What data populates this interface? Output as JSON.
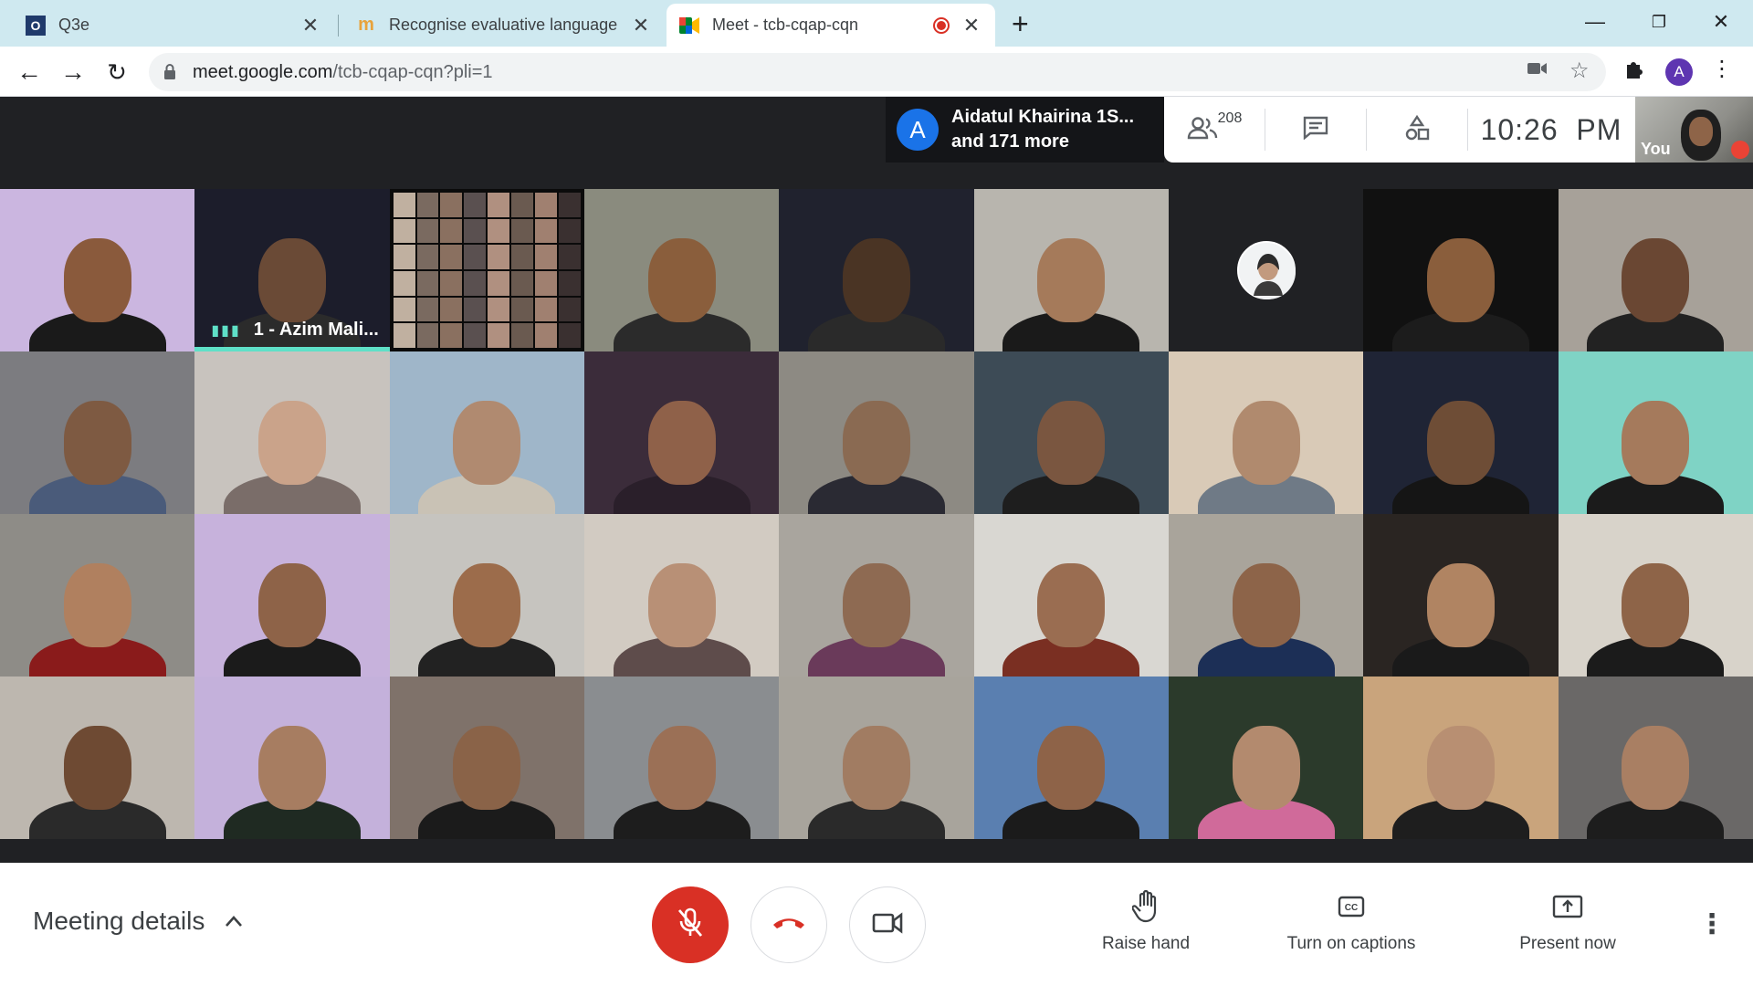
{
  "browser": {
    "tabs": [
      {
        "title": "Q3e",
        "favicon": "O",
        "favicon_bg": "#1f3a6b",
        "active": false
      },
      {
        "title": "Recognise evaluative language",
        "favicon": "m",
        "favicon_bg": "#e8a33c",
        "active": false
      },
      {
        "title": "Meet - tcb-cqap-cqn",
        "favicon": "meet-icon",
        "active": true,
        "recording_indicator": true
      }
    ],
    "new_tab_label": "+",
    "url_host": "meet.google.com",
    "url_path": "/tcb-cqap-cqn?pli=1",
    "profile_initial": "A"
  },
  "meet": {
    "presenter": {
      "avatar_initial": "A",
      "line1": "Aidatul Khairina 1S...",
      "line2": "and 171 more"
    },
    "participant_count": "208",
    "time": "10:26  PM",
    "self_label": "You",
    "speaking_tile_name": "1 - Azim Mali...",
    "tiles": [
      {
        "bg": "#cbb6e0",
        "skin": "#8a5a3c",
        "wear": "#1a1a1a"
      },
      {
        "bg": "#1c1d2b",
        "skin": "#6a4a36",
        "wear": "#2b2b2b",
        "speaking": true
      },
      {
        "collage": true
      },
      {
        "bg": "#8a8b7e",
        "skin": "#8a5e3c",
        "wear": "#2b2b2b"
      },
      {
        "bg": "#20222e",
        "skin": "#4a3424",
        "wear": "#2a2a2a"
      },
      {
        "bg": "#b8b5ae",
        "skin": "#a57a5a",
        "wear": "#1a1a1a"
      },
      {
        "avatar_only": true,
        "bg": "#202124"
      },
      {
        "bg": "#111111",
        "skin": "#8a5e3c",
        "wear": "#1c1c1c"
      },
      {
        "bg": "#a7a199",
        "skin": "#6a4733",
        "wear": "#222222"
      },
      {
        "bg": "#7c7c80",
        "skin": "#7e5a42",
        "wear": "#4a5b7a"
      },
      {
        "bg": "#c8c3be",
        "skin": "#caa38a",
        "wear": "#7a6d69"
      },
      {
        "bg": "#9fb6c9",
        "skin": "#b08a70",
        "wear": "#c9c2b5"
      },
      {
        "bg": "#3b2c3a",
        "skin": "#8f6149",
        "wear": "#2a1f2a"
      },
      {
        "bg": "#8d8a83",
        "skin": "#8a6a52",
        "wear": "#2a2a33"
      },
      {
        "bg": "#3d4b56",
        "skin": "#7a5640",
        "wear": "#1e1e1e"
      },
      {
        "bg": "#d9cab7",
        "skin": "#b08a6e",
        "wear": "#6f7a86"
      },
      {
        "bg": "#1f2435",
        "skin": "#6e4d36",
        "wear": "#151515"
      },
      {
        "bg": "#7fd3c5",
        "skin": "#a57a5c",
        "wear": "#1b1b1b"
      },
      {
        "bg": "#8e8c87",
        "skin": "#b0805f",
        "wear": "#8a1b1b"
      },
      {
        "bg": "#c7b2dc",
        "skin": "#8e6348",
        "wear": "#1b1b1b"
      },
      {
        "bg": "#c6c4bf",
        "skin": "#9c6c4b",
        "wear": "#222222"
      },
      {
        "bg": "#d2cbc2",
        "skin": "#b89076",
        "wear": "#5e4c4b"
      },
      {
        "bg": "#a9a59e",
        "skin": "#8e6a52",
        "wear": "#6a3a5a"
      },
      {
        "bg": "#d9d7d2",
        "skin": "#9a6d51",
        "wear": "#7a2f22"
      },
      {
        "bg": "#a9a49b",
        "skin": "#8d6449",
        "wear": "#1c2f56"
      },
      {
        "bg": "#2a2522",
        "skin": "#b08462",
        "wear": "#1a1a1a"
      },
      {
        "bg": "#d8d3ca",
        "skin": "#8e6448",
        "wear": "#1b1b1b"
      },
      {
        "bg": "#bdb7af",
        "skin": "#6e4a33",
        "wear": "#2a2a2a"
      },
      {
        "bg": "#c4b1db",
        "skin": "#a77d61",
        "wear": "#1f2a22"
      },
      {
        "bg": "#7f726a",
        "skin": "#8a6348",
        "wear": "#1b1b1b"
      },
      {
        "bg": "#8a8d90",
        "skin": "#9b7056",
        "wear": "#1d1d1d"
      },
      {
        "bg": "#a8a49c",
        "skin": "#a17c62",
        "wear": "#2a2a2a"
      },
      {
        "bg": "#5a7fb0",
        "skin": "#8e6348",
        "wear": "#1b1b1b"
      },
      {
        "bg": "#2b3a2b",
        "skin": "#b38a6e",
        "wear": "#d06a9a"
      },
      {
        "bg": "#c9a47c",
        "skin": "#b88f72",
        "wear": "#1e1e1e"
      },
      {
        "bg": "#6a6867",
        "skin": "#a97f63",
        "wear": "#1d1d1d"
      }
    ]
  },
  "controls": {
    "meeting_details": "Meeting details",
    "raise_hand": "Raise hand",
    "captions": "Turn on captions",
    "present": "Present now"
  },
  "colors": {
    "tab_strip": "#cfe9f0",
    "meet_bg": "#202124",
    "speaking_accent": "#5fe0c8",
    "mic_off_red": "#d93025"
  }
}
